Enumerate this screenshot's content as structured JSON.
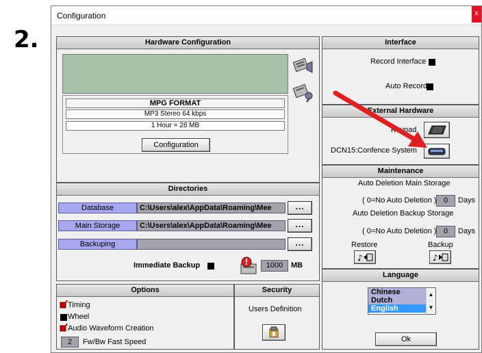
{
  "annotation": {
    "step": "2."
  },
  "window": {
    "title": "Configuration",
    "close_glyph": "x"
  },
  "hardware": {
    "title": "Hardware Configuration",
    "format_title": "MPG FORMAT",
    "format_detail": "MP3 Stereo 64 kbps",
    "format_size": "1 Hour =   28 MB",
    "config_button": "Configuration"
  },
  "directories": {
    "title": "Directories",
    "rows": [
      {
        "label": "Database",
        "path": "C:\\Users\\alex\\AppData\\Roaming\\Mee",
        "browse": "..."
      },
      {
        "label": "Main Storage",
        "path": "C:\\Users\\alex\\AppData\\Roaming\\Mee",
        "browse": "..."
      },
      {
        "label": "Backuping",
        "path": "",
        "browse": "..."
      }
    ],
    "immediate_backup_label": "Immediate Backup",
    "size_value": "1000",
    "size_unit": "MB"
  },
  "options": {
    "title": "Options",
    "items": [
      {
        "label": "Timing",
        "checked": true
      },
      {
        "label": "Wheel",
        "checked": false
      },
      {
        "label": "Audio Waveform Creation",
        "checked": true
      }
    ],
    "speed_value": "2",
    "speed_label": "Fw/Bw Fast Speed"
  },
  "security": {
    "title": "Security",
    "users_label": "Users Definition"
  },
  "interface": {
    "title": "Interface",
    "record_interface": "Record Interface",
    "auto_record": "Auto Record"
  },
  "external": {
    "title": "External Hardware",
    "keypad_label": "Keypad",
    "dcn_label": "DCN15:Confence System"
  },
  "maintenance": {
    "title": "Maintenance",
    "main_title": "Auto Deletion Main Storage",
    "main_hint": "( 0=No Auto Deletion )",
    "main_value": "0",
    "main_unit": "Days",
    "backup_title": "Auto Deletion Backup Storage",
    "backup_hint": "( 0=No Auto Deletion )",
    "backup_value": "0",
    "backup_unit": "Days",
    "restore_label": "Restore",
    "backup_label": "Backup"
  },
  "language": {
    "title": "Language",
    "options": [
      "Chinese",
      "Dutch",
      "English"
    ],
    "selected": "English"
  },
  "ok_button": "Ok",
  "colors": {
    "accent_arrow": "#e02020",
    "display_green": "#a7c2a9",
    "selected_blue": "#3399ff"
  }
}
